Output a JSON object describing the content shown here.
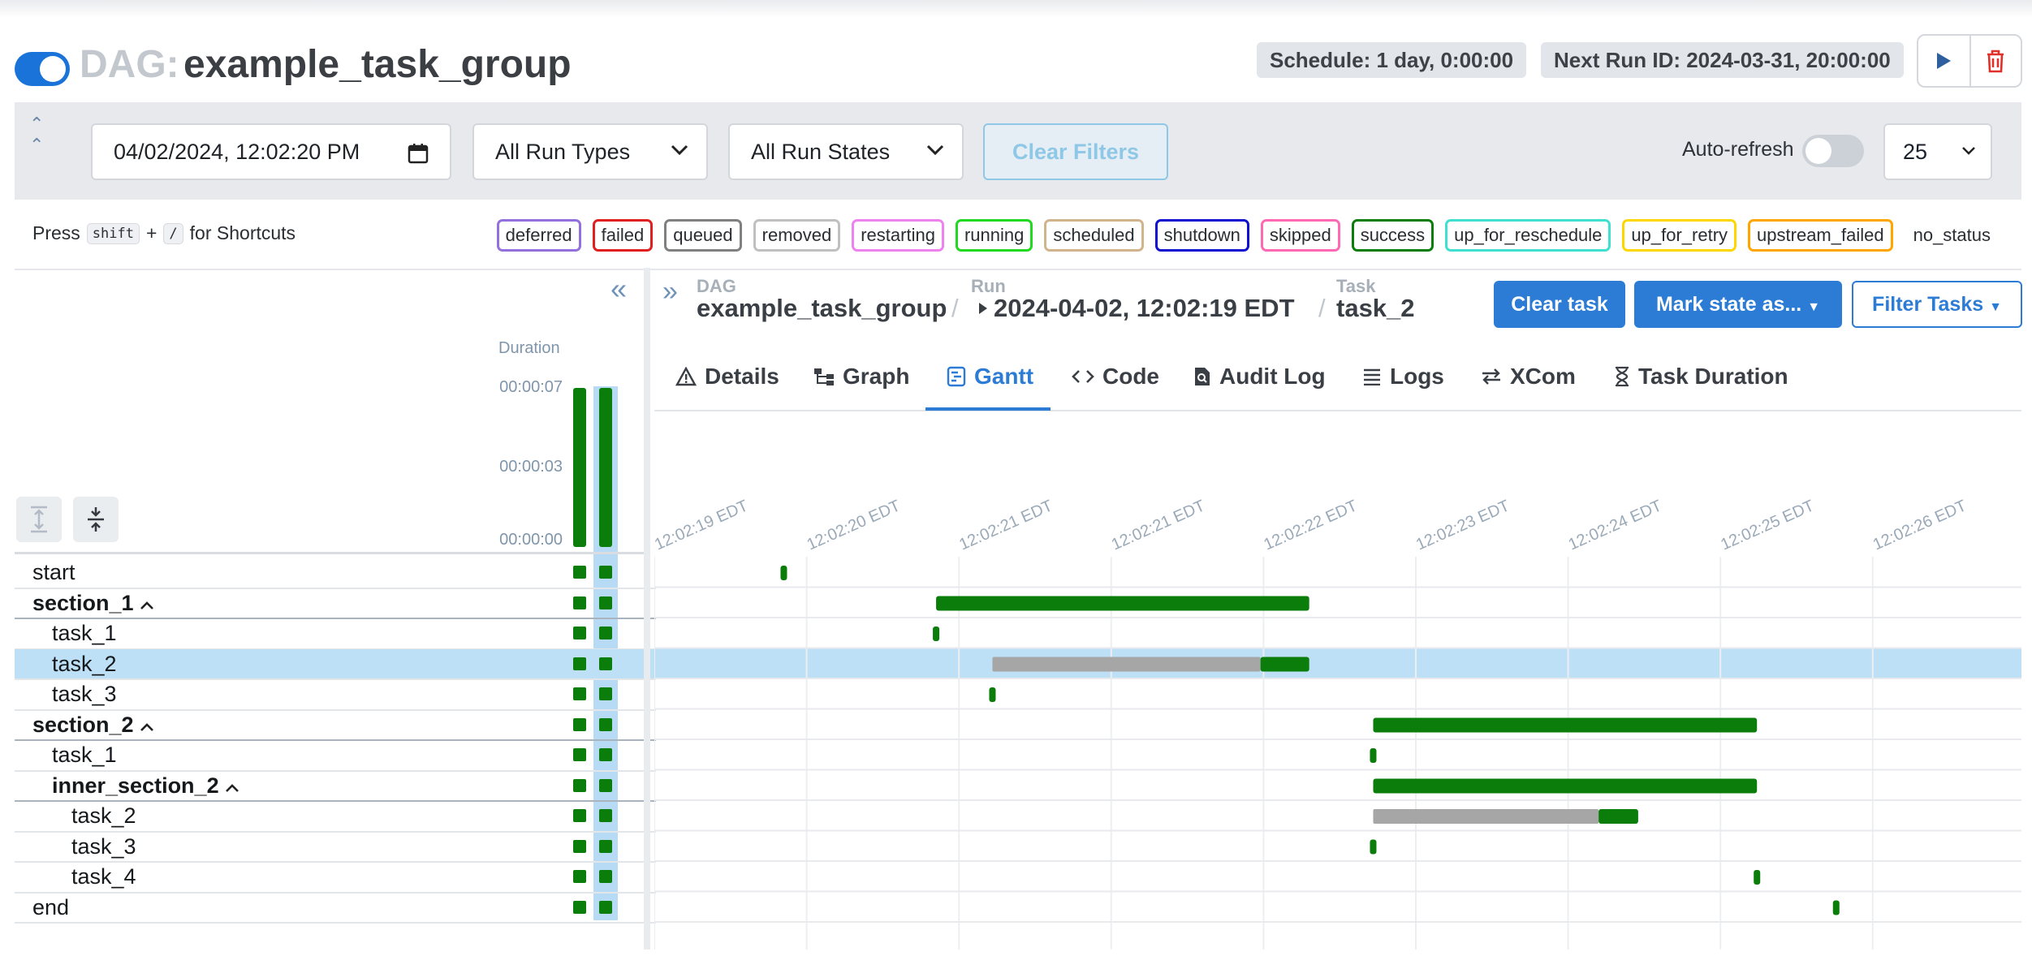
{
  "header": {
    "dag_prefix": "DAG:",
    "dag_name": "example_task_group",
    "schedule": "Schedule: 1 day, 0:00:00",
    "next_run": "Next Run ID: 2024-03-31, 20:00:00"
  },
  "filters": {
    "datetime": "04/02/2024, 12:02:20 PM",
    "run_types": "All Run Types",
    "run_states": "All Run States",
    "clear_filters": "Clear Filters",
    "auto_refresh_label": "Auto-refresh",
    "auto_refresh_on": false,
    "page_size": "25"
  },
  "shortcuts": {
    "press": "Press",
    "key1": "shift",
    "plus": "+",
    "key2": "/",
    "suffix": "for Shortcuts"
  },
  "legend": [
    {
      "label": "deferred",
      "color": "#9370db"
    },
    {
      "label": "failed",
      "color": "#e02020"
    },
    {
      "label": "queued",
      "color": "#808080"
    },
    {
      "label": "removed",
      "color": "#c0c0c0"
    },
    {
      "label": "restarting",
      "color": "#ee82ee"
    },
    {
      "label": "running",
      "color": "#20d920"
    },
    {
      "label": "scheduled",
      "color": "#d2b48c"
    },
    {
      "label": "shutdown",
      "color": "#1010d0"
    },
    {
      "label": "skipped",
      "color": "#ff69b4"
    },
    {
      "label": "success",
      "color": "#0b7d0b"
    },
    {
      "label": "up_for_reschedule",
      "color": "#40e0d0"
    },
    {
      "label": "up_for_retry",
      "color": "#ffd700"
    },
    {
      "label": "upstream_failed",
      "color": "#ffa500"
    },
    {
      "label": "no_status",
      "color": ""
    }
  ],
  "grid": {
    "duration_label": "Duration",
    "duration_ticks": [
      "00:00:07",
      "00:00:03",
      "00:00:00"
    ],
    "run_durations_sec": [
      7,
      7
    ],
    "rows": [
      {
        "label": "start",
        "level": 0,
        "group": false
      },
      {
        "label": "section_1",
        "level": 0,
        "group": true
      },
      {
        "label": "task_1",
        "level": 1,
        "group": false
      },
      {
        "label": "task_2",
        "level": 1,
        "group": false,
        "selected": true
      },
      {
        "label": "task_3",
        "level": 1,
        "group": false
      },
      {
        "label": "section_2",
        "level": 0,
        "group": true
      },
      {
        "label": "task_1",
        "level": 1,
        "group": false
      },
      {
        "label": "inner_section_2",
        "level": 1,
        "group": true
      },
      {
        "label": "task_2",
        "level": 2,
        "group": false
      },
      {
        "label": "task_3",
        "level": 2,
        "group": false
      },
      {
        "label": "task_4",
        "level": 2,
        "group": false
      },
      {
        "label": "end",
        "level": 0,
        "group": false
      }
    ]
  },
  "breadcrumb": {
    "dag_label": "DAG",
    "dag_value": "example_task_group",
    "run_label": "Run",
    "run_value": "2024-04-02, 12:02:19 EDT",
    "task_label": "Task",
    "task_value": "task_2",
    "sep": "/"
  },
  "actions": {
    "clear_task": "Clear task",
    "mark_state": "Mark state as...",
    "filter_tasks": "Filter Tasks"
  },
  "tabs": [
    {
      "label": "Details",
      "icon": "warning-icon"
    },
    {
      "label": "Graph",
      "icon": "graph-icon"
    },
    {
      "label": "Gantt",
      "icon": "gantt-icon",
      "active": true
    },
    {
      "label": "Code",
      "icon": "code-icon"
    },
    {
      "label": "Audit Log",
      "icon": "audit-log-icon"
    },
    {
      "label": "Logs",
      "icon": "logs-icon"
    },
    {
      "label": "XCom",
      "icon": "xcom-icon"
    },
    {
      "label": "Task Duration",
      "icon": "hourglass-icon"
    }
  ],
  "chart_data": {
    "type": "gantt",
    "axis_ticks": [
      "12:02:19 EDT",
      "12:02:20 EDT",
      "12:02:21 EDT",
      "12:02:21 EDT",
      "12:02:22 EDT",
      "12:02:23 EDT",
      "12:02:24 EDT",
      "12:02:25 EDT",
      "12:02:26 EDT"
    ],
    "x_range_sec": [
      0,
      9
    ],
    "colors": {
      "success": "#0b7d0b",
      "queued": "#a6a6a6",
      "selected_row": "#bee0f6"
    },
    "tasks": [
      {
        "row": 0,
        "queued_start": null,
        "start": 0.85,
        "end": 0.85
      },
      {
        "row": 1,
        "queued_start": null,
        "start": 1.85,
        "end": 4.3
      },
      {
        "row": 2,
        "queued_start": null,
        "start": 1.85,
        "end": 1.85
      },
      {
        "row": 3,
        "queued_start": 2.22,
        "start": 3.98,
        "end": 4.3
      },
      {
        "row": 4,
        "queued_start": null,
        "start": 2.22,
        "end": 2.22
      },
      {
        "row": 5,
        "queued_start": null,
        "start": 4.72,
        "end": 7.24
      },
      {
        "row": 6,
        "queued_start": null,
        "start": 4.72,
        "end": 4.72
      },
      {
        "row": 7,
        "queued_start": null,
        "start": 4.72,
        "end": 7.24
      },
      {
        "row": 8,
        "queued_start": 4.72,
        "start": 6.2,
        "end": 6.46
      },
      {
        "row": 9,
        "queued_start": null,
        "start": 4.72,
        "end": 4.72
      },
      {
        "row": 10,
        "queued_start": null,
        "start": 7.24,
        "end": 7.24
      },
      {
        "row": 11,
        "queued_start": null,
        "start": 7.76,
        "end": 7.76
      }
    ]
  }
}
